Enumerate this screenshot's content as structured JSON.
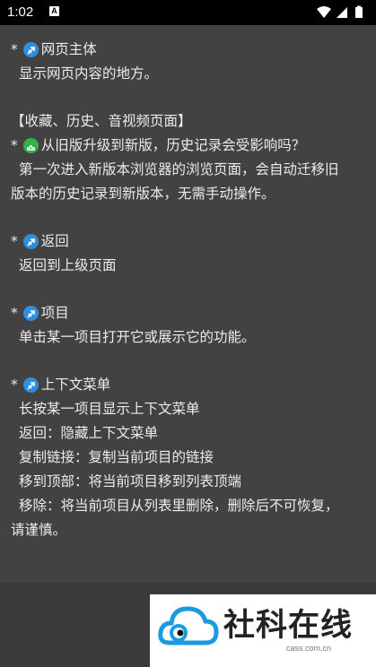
{
  "status": {
    "time": "1:02",
    "notif_letter": "A"
  },
  "sections": {
    "main": {
      "title": "网页主体",
      "desc": "显示网页内容的地方。"
    },
    "history": {
      "header": "【收藏、历史、音视频页面】",
      "question": "从旧版升级到新版，历史记录会受影响吗？",
      "answer_line1": "第一次进入新版本浏览器的浏览页面，会自动迁移旧",
      "answer_line2": "版本的历史记录到新版本，无需手动操作。"
    },
    "back": {
      "title": "返回",
      "desc": "返回到上级页面"
    },
    "item": {
      "title": "项目",
      "desc": "单击某一项目打开它或展示它的功能。"
    },
    "context_menu": {
      "title": "上下文菜单",
      "line1": "长按某一项目显示上下文菜单",
      "line2": "返回：隐藏上下文菜单",
      "line3": "复制链接：复制当前项目的链接",
      "line4": "移到顶部：将当前项目移到列表顶端",
      "line5": "移除：将当前项目从列表里删除，删除后不可恢复，",
      "line6": "请谨慎。"
    }
  },
  "ad": {
    "title": "社科在线",
    "url": "cass.com.cn"
  },
  "icons": {
    "sagittarius": "sagittarius-icon",
    "libra": "libra-icon"
  },
  "colors": {
    "bg": "#424242",
    "text": "#ececec",
    "sag_blue": "#2d8fe0",
    "libra_green": "#36b14a",
    "logo_blue": "#1a9be0"
  }
}
